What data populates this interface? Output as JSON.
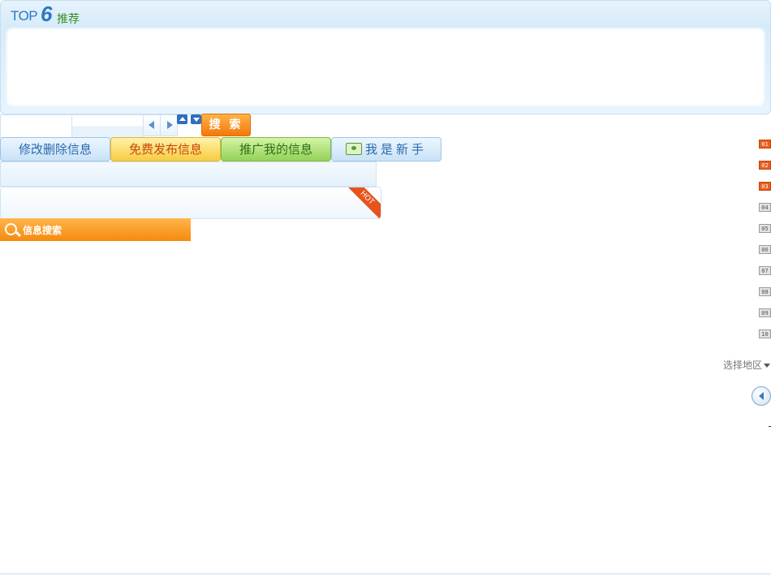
{
  "top6": {
    "title_top": "TOP",
    "title_num": "6",
    "title_label": "推荐"
  },
  "search": {
    "button_label": "搜 索"
  },
  "actions": {
    "edit_label": "修改删除信息",
    "publish_label": "免费发布信息",
    "promote_label": "推广我的信息",
    "newbie_label": "我是新手"
  },
  "hot_label": "HOT",
  "info_search_label": "信息搜索",
  "rank_badges": [
    "01",
    "02",
    "03",
    "04",
    "05",
    "06",
    "07",
    "08",
    "09",
    "10"
  ],
  "region_label": "选择地区",
  "colors": {
    "accent_blue": "#2b77c3",
    "accent_orange": "#f58a0f",
    "hot_red": "#e95e1a"
  }
}
